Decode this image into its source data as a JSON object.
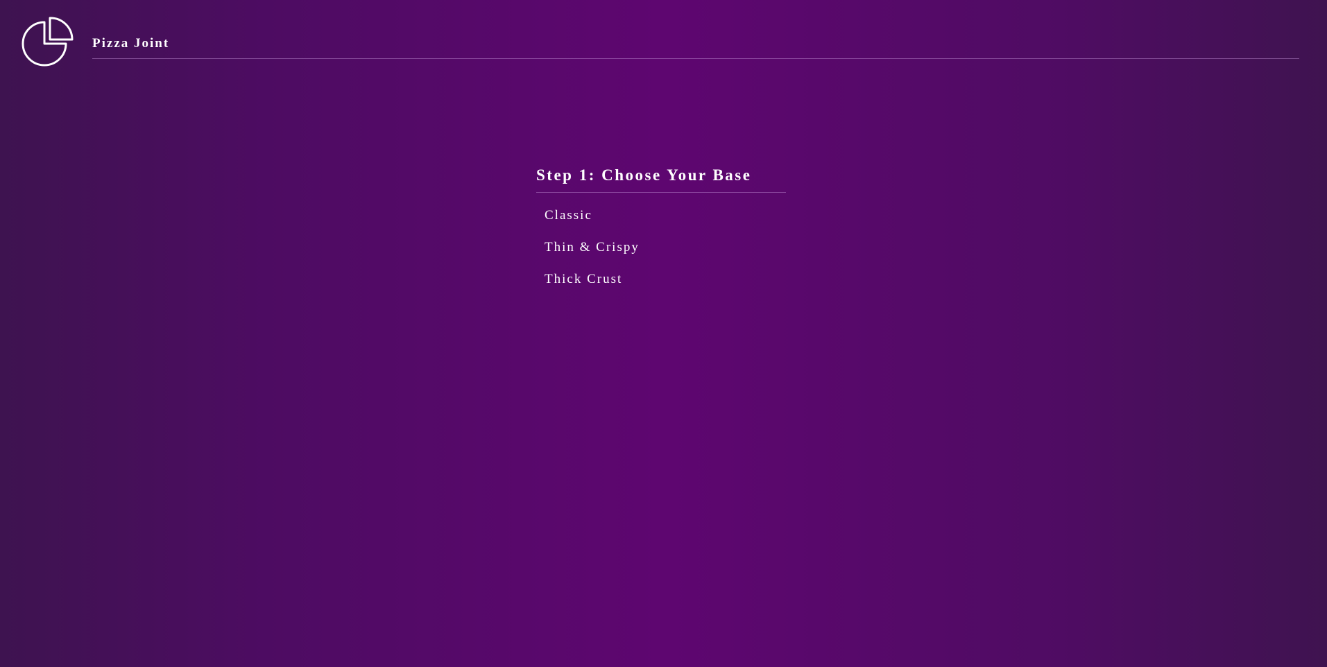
{
  "header": {
    "logo_icon": "pie-chart-icon",
    "brand_name": "Pizza Joint"
  },
  "step": {
    "title": "Step 1: Choose Your Base",
    "options": [
      {
        "label": "Classic"
      },
      {
        "label": "Thin & Crispy"
      },
      {
        "label": "Thick Crust"
      }
    ]
  },
  "colors": {
    "background_center": "#5e0670",
    "background_edge": "#3e1350",
    "text": "#ffffff",
    "divider": "#b77fcf"
  }
}
